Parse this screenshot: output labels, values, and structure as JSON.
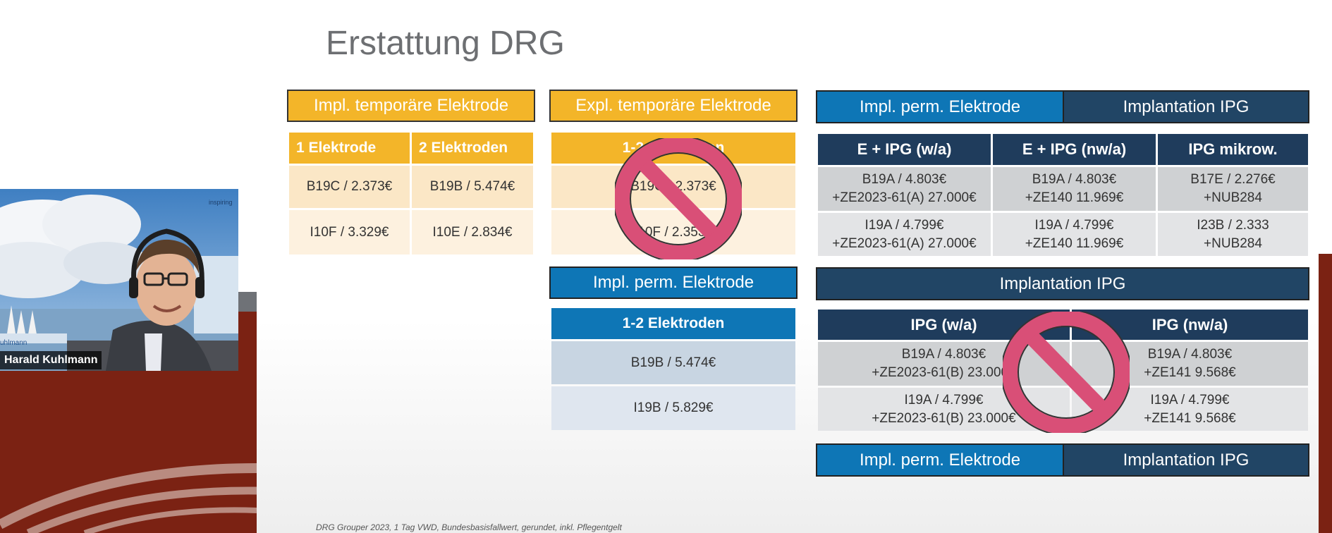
{
  "slide": {
    "title": "Erstattung DRG",
    "footnote": "DRG Grouper 2023, 1 Tag VWD, Bundesbasisfallwert, gerundet, inkl. Pflegentgelt"
  },
  "impl_temp": {
    "title": "Impl. temporäre Elektrode",
    "columns": [
      "1 Elektrode",
      "2 Elektroden"
    ],
    "rows": [
      [
        "B19C / 2.373€",
        "B19B / 5.474€"
      ],
      [
        "I10F / 3.329€",
        "I10E / 2.834€"
      ]
    ]
  },
  "expl_temp": {
    "title": "Expl. temporäre Elektrode",
    "column": "1-2 Elektroden",
    "rows": [
      "B19C / 2.373€",
      "I10F / 2.353€"
    ],
    "crossed_out": true
  },
  "impl_perm_middle": {
    "title": "Impl. perm. Elektrode",
    "column": "1-2 Elektroden",
    "rows": [
      "B19B / 5.474€",
      "I19B / 5.829€"
    ]
  },
  "combined_top": {
    "title_left": "Impl. perm. Elektrode",
    "title_right": "Implantation IPG",
    "columns": [
      "E + IPG (w/a)",
      "E + IPG (nw/a)",
      "IPG mikrow."
    ],
    "rows": [
      [
        [
          "B19A / 4.803€",
          "+ZE2023-61(A) 27.000€"
        ],
        [
          "B19A / 4.803€",
          "+ZE140 11.969€"
        ],
        [
          "B17E / 2.276€",
          "+NUB284"
        ]
      ],
      [
        [
          "I19A / 4.799€",
          "+ZE2023-61(A) 27.000€"
        ],
        [
          "I19A / 4.799€",
          "+ZE140 11.969€"
        ],
        [
          "I23B / 2.333",
          "+NUB284"
        ]
      ]
    ]
  },
  "implantation_ipg": {
    "title": "Implantation IPG",
    "columns": [
      "IPG (w/a)",
      "IPG (nw/a)"
    ],
    "rows": [
      [
        [
          "B19A / 4.803€",
          "+ZE2023-61(B) 23.000€"
        ],
        [
          "B19A / 4.803€",
          "+ZE141 9.568€"
        ]
      ],
      [
        [
          "I19A / 4.799€",
          "+ZE2023-61(B) 23.000€"
        ],
        [
          "I19A / 4.799€",
          "+ZE141 9.568€"
        ]
      ]
    ],
    "crossed_out": true
  },
  "bottom_bar": {
    "title_left": "Impl. perm. Elektrode",
    "title_right": "Implantation IPG"
  },
  "webcam": {
    "participant_name": "Harald Kuhlmann",
    "logo_text": "inspiring",
    "banner_text": "uhlmann"
  },
  "colors": {
    "yellow": "#f3b529",
    "blue": "#0e76b6",
    "navy": "#214565",
    "dark_red": "#7b2213",
    "prohibited": "#d94f77"
  },
  "icons": {
    "prohibited": "prohibited-icon"
  }
}
